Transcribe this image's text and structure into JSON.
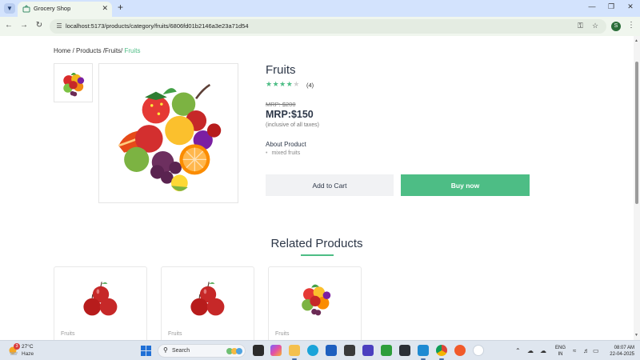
{
  "browser": {
    "tab_title": "Grocery Shop",
    "url": "localhost:5173/products/category/fruits/6806fd01b2146a3e23a71d54",
    "profile_initial": "S"
  },
  "breadcrumb": {
    "home": "Home",
    "sep1": " / ",
    "products": "Products",
    "sep2": " /",
    "category": "Fruits",
    "sep3": "/ ",
    "current": "Fruits"
  },
  "product": {
    "title": "Fruits",
    "rating": 4,
    "rating_max": 5,
    "review_count": "(4)",
    "old_price": "MRP: $200",
    "price": "MRP:$150",
    "tax_note": "(inclusive of all taxes)",
    "about_title": "About Product",
    "about_items": [
      "mixed fruits"
    ],
    "add_to_cart": "Add to Cart",
    "buy_now": "Buy now"
  },
  "related": {
    "title": "Related Products",
    "items": [
      {
        "category": "Fruits",
        "image": "apples"
      },
      {
        "category": "Fruits",
        "image": "apples"
      },
      {
        "category": "Fruits",
        "image": "mixed-fruits"
      }
    ]
  },
  "taskbar": {
    "weather_badge": "3",
    "temperature": "27°C",
    "weather": "Haze",
    "search_label": "Search",
    "lang_line1": "ENG",
    "lang_line2": "IN",
    "time": "08:07 AM",
    "date": "22-04-2025"
  },
  "colors": {
    "accent": "#4dbd85",
    "text_dark": "#2d3748"
  }
}
